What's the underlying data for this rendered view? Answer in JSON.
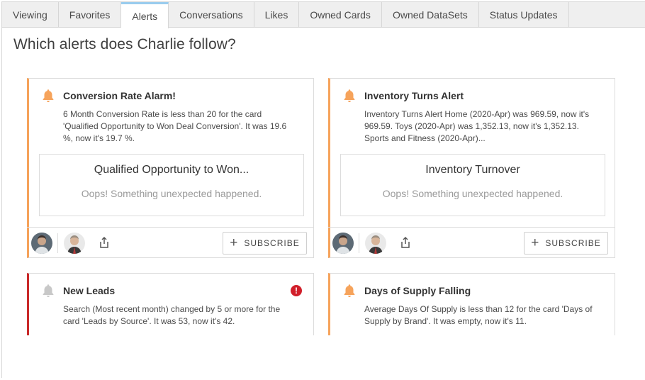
{
  "tabs": [
    {
      "label": "Viewing",
      "active": false
    },
    {
      "label": "Favorites",
      "active": false
    },
    {
      "label": "Alerts",
      "active": true
    },
    {
      "label": "Conversations",
      "active": false
    },
    {
      "label": "Likes",
      "active": false
    },
    {
      "label": "Owned Cards",
      "active": false
    },
    {
      "label": "Owned DataSets",
      "active": false
    },
    {
      "label": "Status Updates",
      "active": false
    }
  ],
  "heading": "Which alerts does Charlie follow?",
  "colors": {
    "accent_orange": "#f6a35b",
    "alert_red": "#c92a2a",
    "bell_orange": "#f6a35b",
    "bell_grey": "#c8c8c8",
    "active_tab_top": "#99ccee"
  },
  "cards": [
    {
      "title": "Conversion Rate Alarm!",
      "icon": "bell-icon",
      "description": "6 Month Conversion Rate is less than 20 for the card 'Qualified Opportunity to Won Deal Conversion'. It was 19.6 %, now it's 19.7 %.",
      "inner_title": "Qualified Opportunity to Won...",
      "inner_message": "Oops! Something unexpected happened.",
      "subscribe_label": "SUBSCRIBE"
    },
    {
      "title": "Inventory Turns Alert",
      "icon": "bell-icon",
      "description": "Inventory Turns Alert Home (2020-Apr) was 969.59, now it's 969.59. Toys (2020-Apr) was 1,352.13, now it's 1,352.13. Sports and Fitness (2020-Apr)...",
      "inner_title": "Inventory Turnover",
      "inner_message": "Oops! Something unexpected happened.",
      "subscribe_label": "SUBSCRIBE"
    },
    {
      "title": "New Leads",
      "icon": "bell-icon",
      "status_icon": "error-icon",
      "status_symbol": "!",
      "description": "Search (Most recent month) changed by 5 or more for the card 'Leads by Source'. It was 53, now it's 42."
    },
    {
      "title": "Days of Supply Falling",
      "icon": "bell-icon",
      "description": "Average Days Of Supply is less than 12 for the card 'Days of Supply by Brand'. It was empty, now it's 11."
    }
  ]
}
